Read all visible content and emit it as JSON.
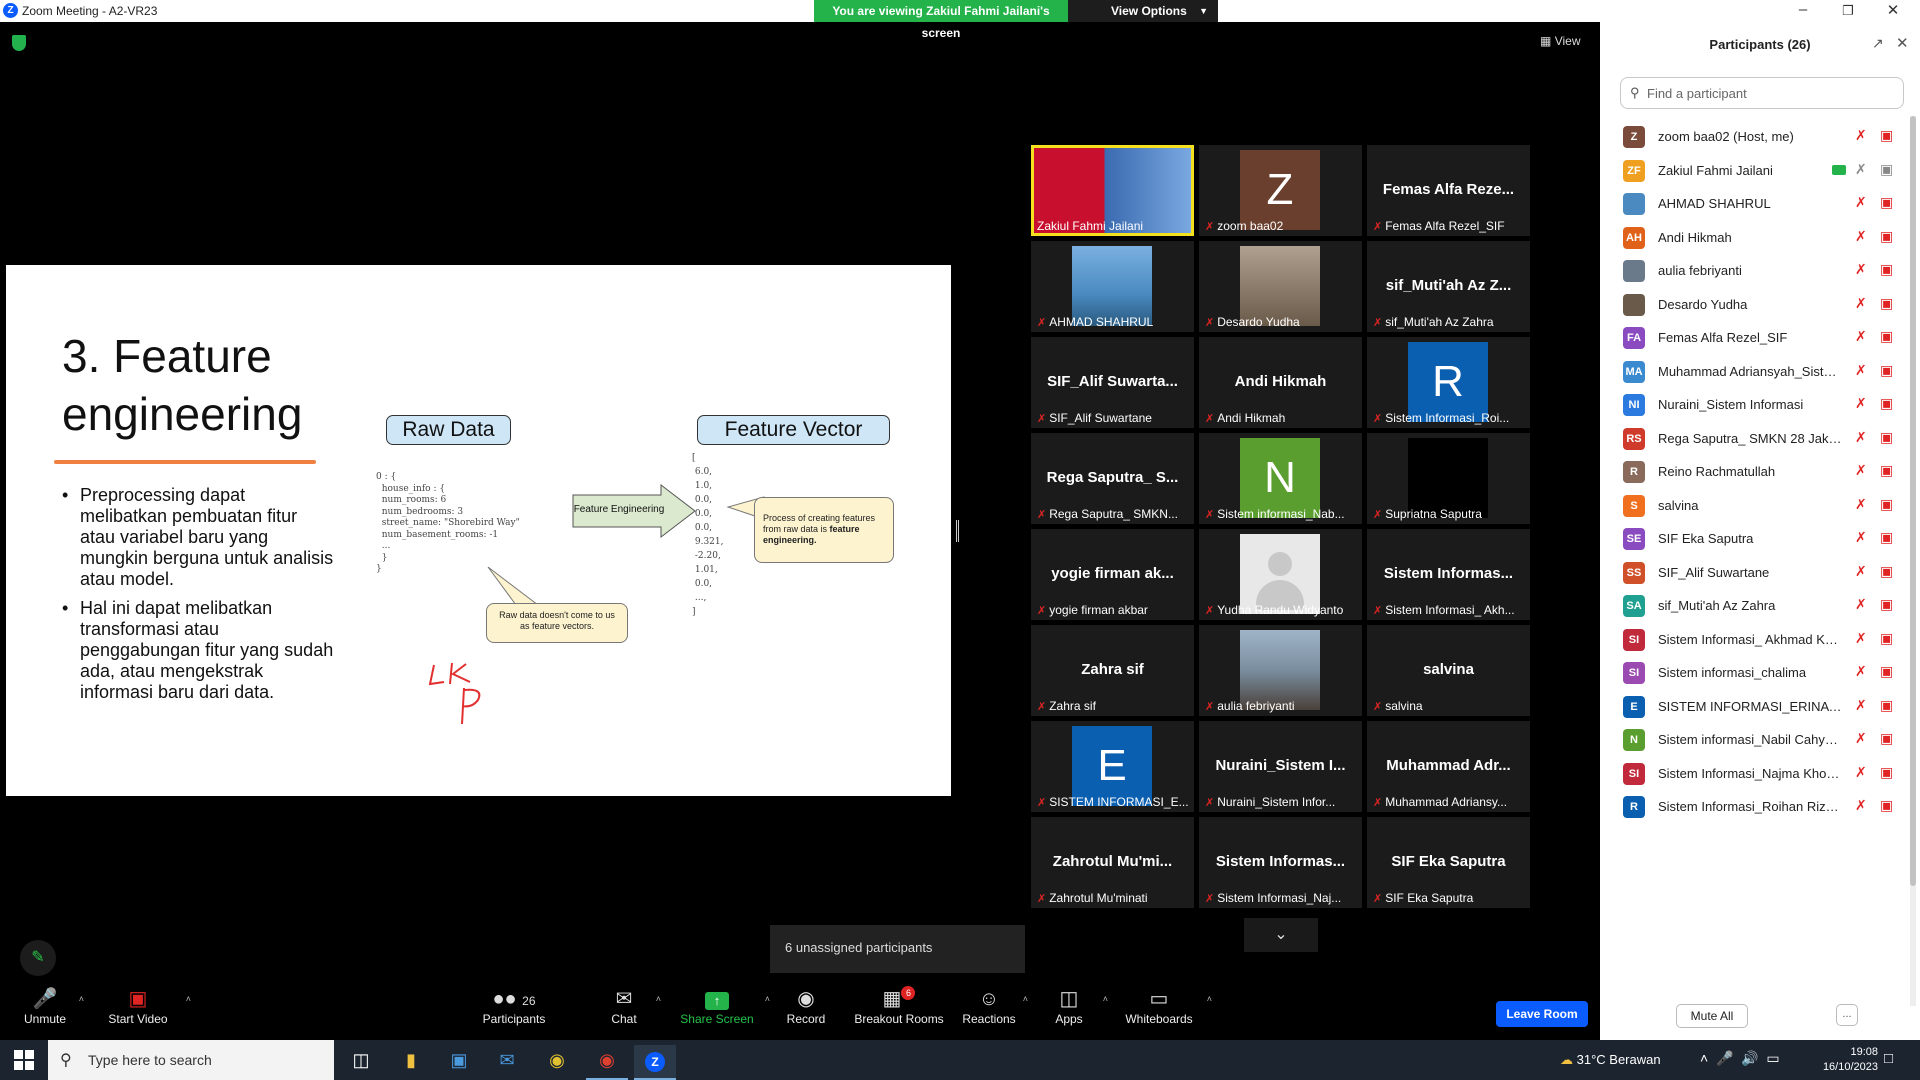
{
  "window": {
    "title": "Zoom Meeting - A2-VR23"
  },
  "banner": {
    "text": "You are viewing Zakiul Fahmi Jailani's screen",
    "view_options": "View Options"
  },
  "view_label": "View",
  "slide": {
    "title": "3. Feature engineering",
    "bullets": [
      "Preprocessing dapat melibatkan pembuatan fitur atau variabel baru yang mungkin berguna untuk analisis atau model.",
      "Hal ini dapat melibatkan transformasi atau penggabungan fitur yang sudah ada, atau mengekstrak informasi baru dari data."
    ],
    "raw_data_label": "Raw Data",
    "feature_vector_label": "Feature Vector",
    "raw_code": "0 : {\n  house_info : {\n  num_rooms: 6\n  num_bedrooms: 3\n  street_name: \"Shorebird Way\"\n  num_basement_rooms: -1\n  ...\n  }\n}",
    "feature_code": "[\n 6.0,\n 1.0,\n 0.0,\n 0.0,\n 0.0,\n 9.321,\n -2.20,\n 1.01,\n 0.0,\n ...,\n]",
    "arrow_label": "Feature Engineering",
    "bubble_process": "Process of creating features from raw data is",
    "bubble_process_bold": "feature engineering.",
    "bubble_raw": "Raw data doesn't come to us as feature vectors."
  },
  "gallery": [
    {
      "name": "",
      "label": "Zakiul Fahmi Jailani",
      "kind": "screen",
      "muted": false
    },
    {
      "name": "",
      "label": "zoom baa02",
      "kind": "letter",
      "letter": "Z",
      "color": "#6b3f2e",
      "muted": true
    },
    {
      "name": "Femas Alfa Reze...",
      "label": "Femas Alfa Rezel_SIF",
      "kind": "name",
      "muted": true
    },
    {
      "name": "",
      "label": "AHMAD SHAHRUL",
      "kind": "photo",
      "color": "#4a8ac0",
      "muted": true
    },
    {
      "name": "",
      "label": "Desardo Yudha",
      "kind": "photo",
      "color": "#6a5a4a",
      "muted": true
    },
    {
      "name": "sif_Muti'ah Az Z...",
      "label": "sif_Muti'ah Az Zahra",
      "kind": "name",
      "muted": true
    },
    {
      "name": "SIF_Alif Suwarta...",
      "label": "SIF_Alif Suwartane",
      "kind": "name",
      "muted": true
    },
    {
      "name": "Andi Hikmah",
      "label": "Andi Hikmah",
      "kind": "name",
      "muted": true
    },
    {
      "name": "",
      "label": "Sistem Informasi_Roi...",
      "kind": "letter",
      "letter": "R",
      "color": "#0b5fb0",
      "muted": true
    },
    {
      "name": "Rega Saputra_ S...",
      "label": "Rega Saputra_ SMKN...",
      "kind": "name",
      "muted": true
    },
    {
      "name": "",
      "label": "Sistem informasi_Nab...",
      "kind": "letter",
      "letter": "N",
      "color": "#5a9e2f",
      "muted": true
    },
    {
      "name": "",
      "label": "Supriatna Saputra",
      "kind": "photo",
      "color": "#000000",
      "muted": true
    },
    {
      "name": "yogie firman ak...",
      "label": "yogie firman akbar",
      "kind": "name",
      "muted": true
    },
    {
      "name": "",
      "label": "Yudha Randu Widyanto",
      "kind": "photo",
      "color": "#e8e8e8",
      "muted": true
    },
    {
      "name": "Sistem Informas...",
      "label": "Sistem Informasi_ Akh...",
      "kind": "name",
      "muted": true
    },
    {
      "name": "Zahra sif",
      "label": "Zahra sif",
      "kind": "name",
      "muted": true
    },
    {
      "name": "",
      "label": "aulia febriyanti",
      "kind": "photo",
      "color": "#7a8ea0",
      "muted": true
    },
    {
      "name": "salvina",
      "label": "salvina",
      "kind": "name",
      "muted": true
    },
    {
      "name": "",
      "label": "SISTEM INFORMASI_E...",
      "kind": "letter",
      "letter": "E",
      "color": "#0b5fb0",
      "muted": true
    },
    {
      "name": "Nuraini_Sistem I...",
      "label": "Nuraini_Sistem Infor...",
      "kind": "name",
      "muted": true
    },
    {
      "name": "Muhammad Adr...",
      "label": "Muhammad Adriansy...",
      "kind": "name",
      "muted": true
    },
    {
      "name": "Zahrotul Mu'mi...",
      "label": "Zahrotul Mu'minati",
      "kind": "name",
      "muted": true
    },
    {
      "name": "Sistem Informas...",
      "label": "Sistem Informasi_Naj...",
      "kind": "name",
      "muted": true
    },
    {
      "name": "SIF Eka Saputra",
      "label": "SIF Eka Saputra",
      "kind": "name",
      "muted": true
    }
  ],
  "unassigned": "6 unassigned participants",
  "toolbar": {
    "unmute": "Unmute",
    "start_video": "Start Video",
    "participants": "Participants",
    "participants_count": "26",
    "chat": "Chat",
    "share_screen": "Share Screen",
    "record": "Record",
    "breakout_rooms": "Breakout Rooms",
    "breakout_count": "6",
    "reactions": "Reactions",
    "apps": "Apps",
    "whiteboards": "Whiteboards",
    "leave_room": "Leave Room"
  },
  "panel": {
    "title": "Participants (26)",
    "search_placeholder": "Find a participant",
    "mute_all": "Mute All",
    "more": "...",
    "participants": [
      {
        "initials": "Z",
        "name": "zoom baa02 (Host, me)",
        "color": "#7a4a3a"
      },
      {
        "initials": "ZF",
        "name": "Zakiul Fahmi Jailani",
        "color": "#f0a020",
        "sharing": true
      },
      {
        "initials": "",
        "name": "AHMAD SHAHRUL",
        "color": "#4a8ac0"
      },
      {
        "initials": "AH",
        "name": "Andi Hikmah",
        "color": "#e0621a"
      },
      {
        "initials": "",
        "name": "aulia febriyanti",
        "color": "#6a7a8a"
      },
      {
        "initials": "",
        "name": "Desardo Yudha",
        "color": "#6a5a4a"
      },
      {
        "initials": "FA",
        "name": "Femas Alfa Rezel_SIF",
        "color": "#8a4ac0"
      },
      {
        "initials": "MA",
        "name": "Muhammad Adriansyah_Sistem...",
        "color": "#3a8ad0"
      },
      {
        "initials": "NI",
        "name": "Nuraini_Sistem Informasi",
        "color": "#2a7ae0"
      },
      {
        "initials": "RS",
        "name": "Rega Saputra_ SMKN 28 Jakarta",
        "color": "#d03a2a"
      },
      {
        "initials": "R",
        "name": "Reino Rachmatullah",
        "color": "#8a6a5a"
      },
      {
        "initials": "S",
        "name": "salvina",
        "color": "#f07020"
      },
      {
        "initials": "SE",
        "name": "SIF Eka Saputra",
        "color": "#8a4ac0"
      },
      {
        "initials": "SS",
        "name": "SIF_Alif Suwartane",
        "color": "#d0502a"
      },
      {
        "initials": "SA",
        "name": "sif_Muti'ah Az Zahra",
        "color": "#20a090"
      },
      {
        "initials": "SI",
        "name": "Sistem Informasi_ Akhmad Khal...",
        "color": "#c02a3a"
      },
      {
        "initials": "SI",
        "name": "Sistem informasi_chalima",
        "color": "#9a4ab0"
      },
      {
        "initials": "E",
        "name": "SISTEM INFORMASI_ERINA NA...",
        "color": "#0b5fb0"
      },
      {
        "initials": "N",
        "name": "Sistem informasi_Nabil Cahyadi...",
        "color": "#5a9e2f"
      },
      {
        "initials": "SI",
        "name": "Sistem Informasi_Najma Khons...",
        "color": "#c02a3a"
      },
      {
        "initials": "R",
        "name": "Sistem Informasi_Roihan Rizki ...",
        "color": "#0b5fb0"
      }
    ]
  },
  "taskbar": {
    "search_placeholder": "Type here to search",
    "weather": "31°C  Berawan",
    "time": "19:08",
    "date": "16/10/2023"
  }
}
